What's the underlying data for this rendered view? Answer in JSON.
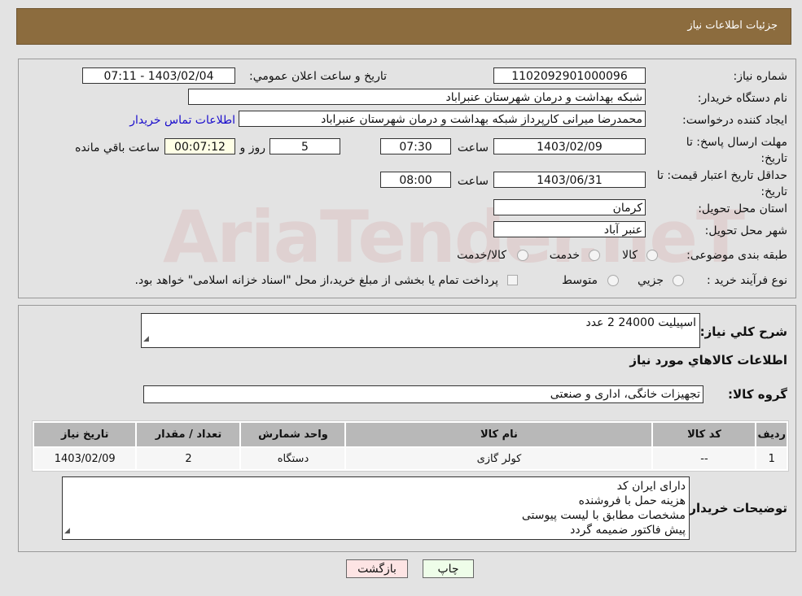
{
  "header": {
    "title": "جزئیات اطلاعات نیاز"
  },
  "watermark": "AriaTender.neT",
  "fields": {
    "need_number_label": "شماره نیاز:",
    "need_number": "1102092901000096",
    "announce_label": "تاریخ و ساعت اعلان عمومي:",
    "announce_value": "1403/02/04 - 07:11",
    "buyer_org_label": "نام دستگاه خريدار:",
    "buyer_org": "شبکه بهداشت و درمان شهرستان عنبراباد",
    "creator_label": "ایجاد کننده درخواست:",
    "creator": "محمدرضا میرانی کارپرداز  شبکه بهداشت و درمان شهرستان عنبراباد",
    "contact_link": "اطلاعات تماس خريدار",
    "deadline_label": "مهلت ارسال پاسخ: تا تاريخ:",
    "deadline_date": "1403/02/09",
    "time_label": "ساعت",
    "deadline_time": "07:30",
    "days": "5",
    "days_label": "روز و",
    "remaining": "00:07:12",
    "remaining_label": "ساعت باقي مانده",
    "validity_label": "حداقل تاريخ اعتبار قيمت: تا تاريخ:",
    "validity_date": "1403/06/31",
    "validity_time": "08:00",
    "province_label": "استان محل تحويل:",
    "province": "كرمان",
    "city_label": "شهر محل تحويل:",
    "city": "عنبر آباد",
    "category_label": "طبقه بندی موضوعی:",
    "category_options": [
      "كالا",
      "خدمت",
      "كالا/خدمت"
    ],
    "process_label": "نوع فرآيند خريد :",
    "process_options": [
      "جزيي",
      "متوسط"
    ],
    "process_note": "پرداخت تمام یا بخشی از مبلغ خرید،از محل \"اسناد خزانه اسلامی\" خواهد بود."
  },
  "details": {
    "desc_label": "شرح كلي نياز:",
    "desc": "اسپیلیت 24000 2 عدد",
    "goods_heading": "اطلاعات كالاهاي مورد نياز",
    "group_label": "گروه کالا:",
    "group": "تجهیزات خانگی، اداری و صنعتی",
    "table": {
      "headers": [
        "رديف",
        "کد کالا",
        "نام کالا",
        "واحد شمارش",
        "تعداد / مقدار",
        "تاریخ نیاز"
      ],
      "rows": [
        [
          "1",
          "--",
          "کولر گازی",
          "دستگاه",
          "2",
          "1403/02/09"
        ]
      ]
    },
    "notes_label": "توضيحات خريدار:",
    "notes": [
      "دارای ایران کد",
      "هزینه حمل با فروشنده",
      "مشخصات  مطابق با لیست پیوستی",
      "پیش فاکتور ضمیمه گردد"
    ]
  },
  "buttons": {
    "back": "بازگشت",
    "print": "چاپ"
  },
  "colors": {
    "header": "#8c6c3e",
    "back_button": "#fde4e4",
    "print_button": "#eefde9",
    "link": "#1a0dcc"
  }
}
